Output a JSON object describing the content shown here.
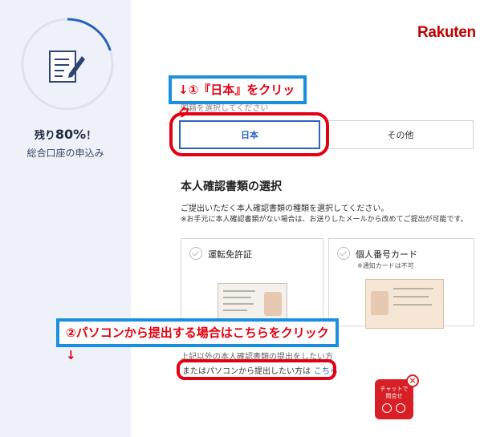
{
  "sidebar": {
    "remaining_prefix": "残り",
    "remaining_pct": "80%",
    "remaining_suffix": "！",
    "subtitle": "総合口座の申込み",
    "progress": 0.8
  },
  "brand": {
    "logo": "Rakuten",
    "color": "#bf0000"
  },
  "callouts": {
    "step1": "↓①『日本』をクリック",
    "step2": "②パソコンから提出する場合はこちらをクリック↓"
  },
  "country": {
    "partial_label": "国籍を選択してください",
    "options": [
      "日本",
      "その他"
    ],
    "selected": "日本"
  },
  "id_docs": {
    "title": "本人確認書類の選択",
    "desc1": "ご提出いただく本人確認書類の種類を選択してください。",
    "desc2": "※お手元に本人確認書類がない場合は、お送りしたメールから改めてご提出が可能です。",
    "cards": [
      {
        "label": "運転免許証",
        "note": ""
      },
      {
        "label": "個人番号カード",
        "note": "※通知カードは不可"
      }
    ]
  },
  "pc_option": {
    "partial_text": "上記以外の本人確認書類の提出をしたい方",
    "text": "またはパソコンから提出したい方は",
    "link": "こちら"
  },
  "chat": {
    "label_line1": "チャットで",
    "label_line2": "問合せ",
    "close": "×"
  },
  "colors": {
    "accent": "#2b62c0",
    "annotation_red": "#e30012",
    "annotation_blue": "#1a8fe0"
  }
}
